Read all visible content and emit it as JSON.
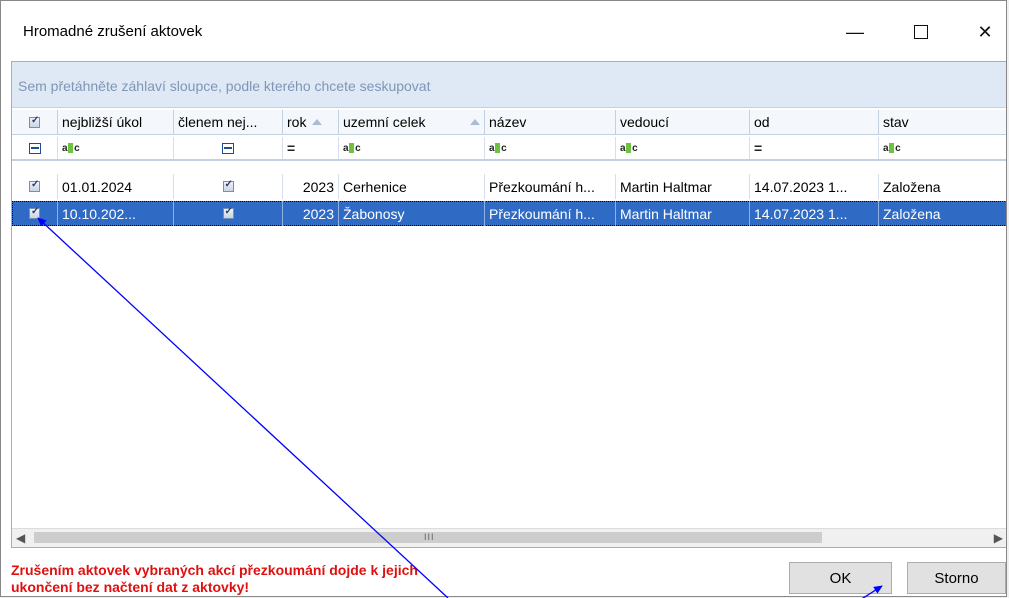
{
  "window": {
    "title": "Hromadné zrušení aktovek",
    "minimize_glyph": "—",
    "close_glyph": "✕"
  },
  "grid": {
    "group_panel_text": "Sem přetáhněte záhlaví sloupce, podle kterého chcete seskupovat",
    "columns": [
      "",
      "nejbližší úkol",
      "členem nej...",
      "rok",
      "uzemní celek",
      "název",
      "vedoucí",
      "od",
      "stav"
    ],
    "rows": [
      {
        "checked": true,
        "nejblizsi_ukol": "01.01.2024",
        "clenem": true,
        "rok": "2023",
        "uzemni_celek": "Cerhenice",
        "nazev": "Přezkoumání h...",
        "vedouci": "Martin Haltmar",
        "od": "14.07.2023 1...",
        "stav": "Založena"
      },
      {
        "checked": true,
        "nejblizsi_ukol": "10.10.202...",
        "clenem": true,
        "rok": "2023",
        "uzemni_celek": "Žabonosy",
        "nazev": "Přezkoumání h...",
        "vedouci": "Martin Haltmar",
        "od": "14.07.2023 1...",
        "stav": "Založena",
        "selected": true
      }
    ],
    "scroll_grip": "III"
  },
  "footer": {
    "warning": "Zrušením aktovek vybraných akcí přezkoumání dojde k jejich ukončení bez načtení dat z aktovky!",
    "ok_label": "OK",
    "storno_label": "Storno"
  },
  "colors": {
    "selection": "#2f6bc4",
    "warning": "#e01010",
    "annotation_arrow": "#0000ff"
  }
}
